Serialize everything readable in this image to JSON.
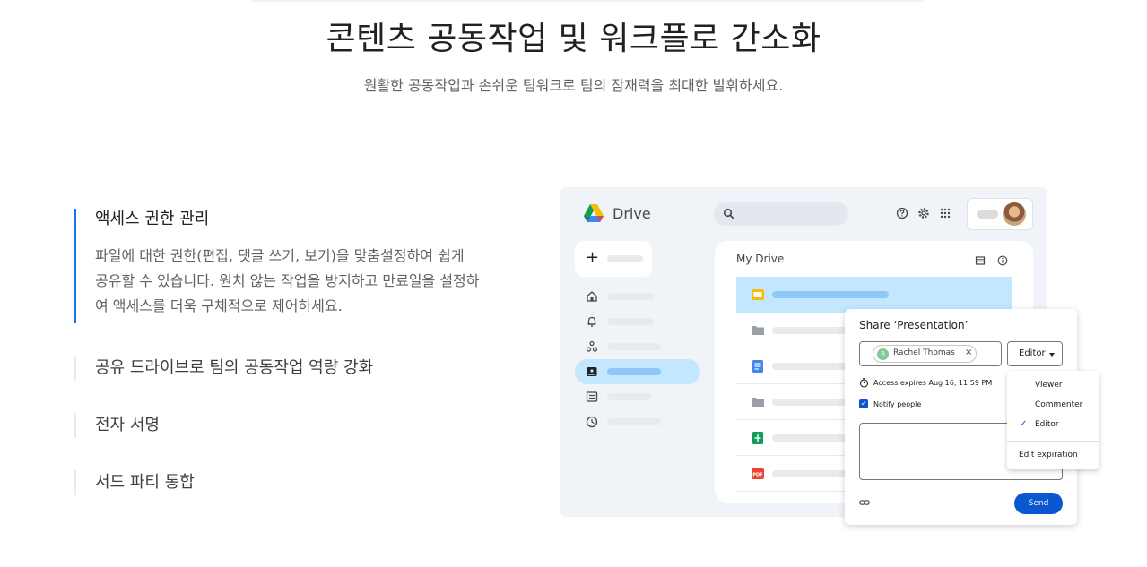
{
  "hero": {
    "title": "콘텐츠 공동작업 및 워크플로 간소화",
    "subtitle": "원활한 공동작업과 손쉬운 팀워크로 팀의 잠재력을 최대한 발휘하세요."
  },
  "features": [
    {
      "title": "액세스 권한 관리",
      "description": "파일에 대한 권한(편집, 댓글 쓰기, 보기)을 맞춤설정하여 쉽게 공유할 수 있습니다. 원치 않는 작업을 방지하고 만료일을 설정하여 액세스를 더욱 구체적으로 제어하세요.",
      "active": true
    },
    {
      "title": "공유 드라이브로 팀의 공동작업 역량 강화",
      "active": false
    },
    {
      "title": "전자 서명",
      "active": false
    },
    {
      "title": "서드 파티 통합",
      "active": false
    }
  ],
  "drive": {
    "app_name": "Drive",
    "content_title": "My Drive",
    "colors": {
      "selected": "#c2e7ff",
      "accent": "#0b57d0",
      "background": "#f0f4f9"
    },
    "file_icons": [
      "slides-icon",
      "folder-icon",
      "docs-icon",
      "folder-icon",
      "sheets-icon",
      "pdf-icon"
    ],
    "pdf_label": "PDF"
  },
  "share_dialog": {
    "title": "Share ‘Presentation’",
    "person_initial": "R",
    "person_name": "Rachel Thomas",
    "remove_symbol": "×",
    "role": "Editor",
    "access_expires": "Access expires Aug 16, 11:59 PM",
    "notify_label": "Notify people",
    "send_label": "Send"
  },
  "role_menu": {
    "items": [
      "Viewer",
      "Commenter",
      "Editor"
    ],
    "selected": "Editor",
    "check_symbol": "✓",
    "edit_expiration": "Edit expiration"
  }
}
